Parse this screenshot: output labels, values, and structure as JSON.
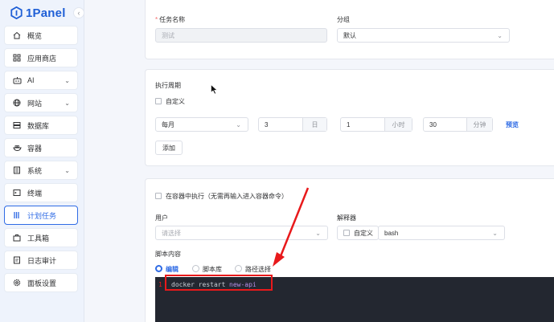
{
  "app": {
    "brand": "1Panel"
  },
  "sidebar": {
    "items": [
      {
        "label": "概览",
        "icon": "home-icon"
      },
      {
        "label": "应用商店",
        "icon": "apps-grid-icon"
      },
      {
        "label": "AI",
        "icon": "robot-icon",
        "expandable": true
      },
      {
        "label": "网站",
        "icon": "globe-icon",
        "expandable": true
      },
      {
        "label": "数据库",
        "icon": "database-icon"
      },
      {
        "label": "容器",
        "icon": "container-icon"
      },
      {
        "label": "系统",
        "icon": "system-icon",
        "expandable": true
      },
      {
        "label": "终端",
        "icon": "terminal-icon"
      },
      {
        "label": "计划任务",
        "icon": "cron-icon",
        "active": true
      },
      {
        "label": "工具箱",
        "icon": "toolbox-icon"
      },
      {
        "label": "日志审计",
        "icon": "log-icon"
      },
      {
        "label": "面板设置",
        "icon": "settings-icon"
      }
    ]
  },
  "task": {
    "name_label": "任务名称",
    "name_value": "测试",
    "group_label": "分组",
    "group_value": "默认"
  },
  "schedule": {
    "title": "执行周期",
    "custom_label": "自定义",
    "period_value": "每月",
    "day_value": "3",
    "day_unit": "日",
    "hour_value": "1",
    "hour_unit": "小时",
    "minute_value": "30",
    "minute_unit": "分钟",
    "preview_link": "预览",
    "add_button": "添加"
  },
  "script": {
    "in_container_label": "在容器中执行（无需再输入进入容器命令）",
    "user_label": "用户",
    "user_placeholder": "请选择",
    "interpreter_label": "解释器",
    "interpreter_custom_label": "自定义",
    "interpreter_value": "bash",
    "content_label": "脚本内容",
    "modes": [
      "编辑",
      "脚本库",
      "路径选择"
    ],
    "selected_mode": "编辑",
    "line_number": "1",
    "code": {
      "cmd": "docker restart ",
      "arg": "new-api"
    }
  },
  "colors": {
    "accent": "#2f6be5",
    "annotation_red": "#e8191b",
    "editor_bg": "#232730"
  }
}
